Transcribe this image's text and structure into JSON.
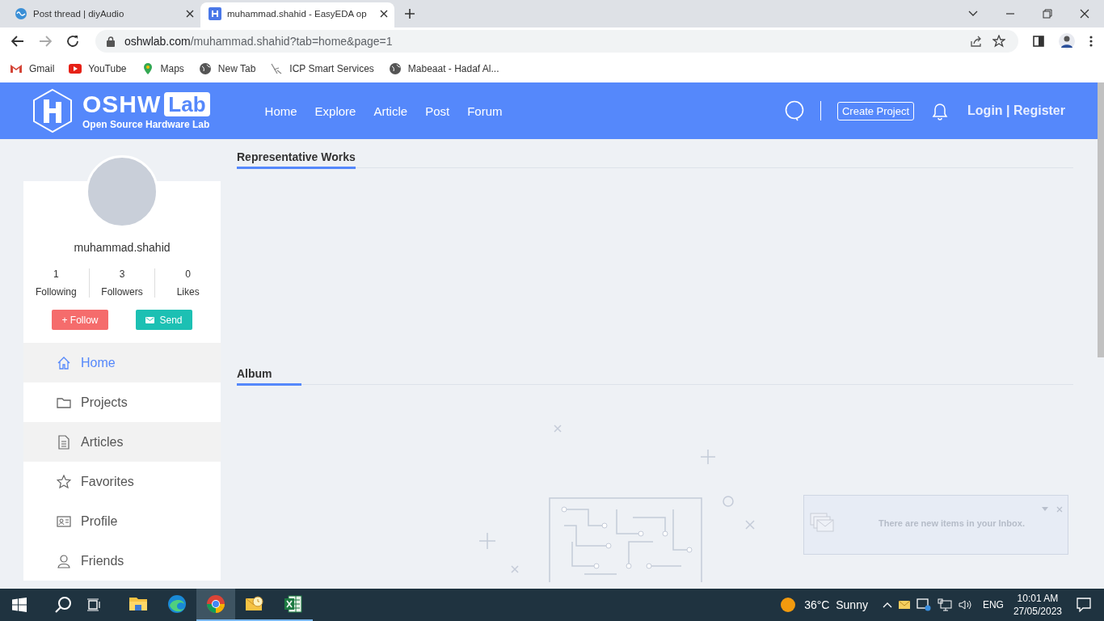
{
  "browser": {
    "tabs": [
      {
        "title": "Post thread | diyAudio",
        "selected": false
      },
      {
        "title": "muhammad.shahid - EasyEDA op",
        "selected": true
      }
    ],
    "address": "oshwlab.com/muhammad.shahid?tab=home&page=1",
    "bookmarks": [
      "Gmail",
      "YouTube",
      "Maps",
      "New Tab",
      "ICP Smart Services",
      "Mabeaat - Hadaf Al..."
    ]
  },
  "header": {
    "logo": {
      "name": "OSHW",
      "badge": "Lab",
      "tagline": "Open Source Hardware Lab"
    },
    "nav": [
      "Home",
      "Explore",
      "Article",
      "Post",
      "Forum"
    ],
    "create_button": "Create Project",
    "login": "Login | Register"
  },
  "profile": {
    "username": "muhammad.shahid",
    "stats": [
      {
        "value": "1",
        "label": "Following"
      },
      {
        "value": "3",
        "label": "Followers"
      },
      {
        "value": "0",
        "label": "Likes"
      }
    ],
    "follow_button": "+ Follow",
    "send_button": "Send",
    "menu": [
      {
        "label": "Home",
        "selected": true,
        "hovered": false
      },
      {
        "label": "Projects",
        "selected": false,
        "hovered": false
      },
      {
        "label": "Articles",
        "selected": false,
        "hovered": true
      },
      {
        "label": "Favorites",
        "selected": false,
        "hovered": false
      },
      {
        "label": "Profile",
        "selected": false,
        "hovered": false
      },
      {
        "label": "Friends",
        "selected": false,
        "hovered": false
      }
    ]
  },
  "sections": [
    "Representative Works",
    "Album"
  ],
  "notification": {
    "message": "There are new items in your Inbox."
  },
  "taskbar": {
    "apps": [
      {
        "running": false,
        "active": false
      },
      {
        "running": false,
        "active": false
      },
      {
        "running": true,
        "active": true
      },
      {
        "running": true,
        "active": false
      },
      {
        "running": true,
        "active": false
      }
    ],
    "weather": "36°C  Sunny",
    "language": "ENG",
    "time": "10:01 AM",
    "date": "27/05/2023"
  }
}
